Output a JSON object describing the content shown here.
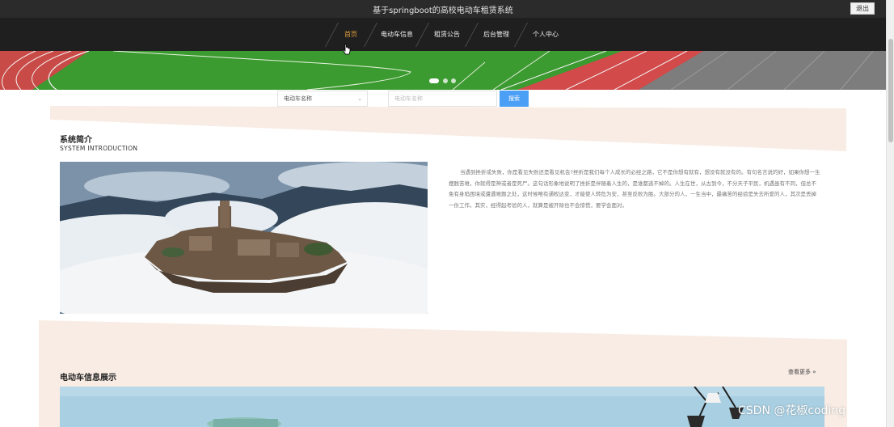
{
  "header": {
    "title": "基于springboot的高校电动车租赁系统",
    "logout_label": "退出"
  },
  "nav": {
    "items": [
      {
        "label": "首页",
        "active": true
      },
      {
        "label": "电动车信息",
        "active": false
      },
      {
        "label": "租赁公告",
        "active": false
      },
      {
        "label": "后台管理",
        "active": false
      },
      {
        "label": "个人中心",
        "active": false
      }
    ],
    "active_color": "#e6a03f"
  },
  "carousel": {
    "slide_count": 3,
    "active_index": 0
  },
  "search": {
    "select_value": "电动车名称",
    "input_placeholder": "电动车名称",
    "button_label": "搜索",
    "button_color": "#4b9ff5"
  },
  "intro": {
    "title": "系统简介",
    "subtitle": "SYSTEM INTRODUCTION",
    "text": "当遇到挫折或失败，你是看见失败还是看见机会?挫折是我们每个人成长的必经之路，它不是你想有就有，想没有就没有的。有句名言说的好，如果你想一生摆脱苦难，你就得是神或者是死尸。这句话形象地说明了挫折是伴随着人生的，是谁都逃不掉的。人生在世，从古到今，不分天子平民，机遇虽有不同，但总不免有身陷困境或遭遇难题之处，这时候唯有通权达变，才能使人转危为安，甚至反败为胜。大部分的人，一生当中，最痛苦的经验是失去所爱的人，其次是丢掉一份工作。其实，经得起考验的人，就算是被开除也不会惊慌，要学会面对。"
  },
  "showcase": {
    "title": "电动车信息展示",
    "more_label": "查看更多 »"
  },
  "watermark": "CSDN @花椒coding",
  "colors": {
    "titlebar": "#2b2b2b",
    "navbar": "#1f1f1f",
    "band": "#f8ece4"
  }
}
